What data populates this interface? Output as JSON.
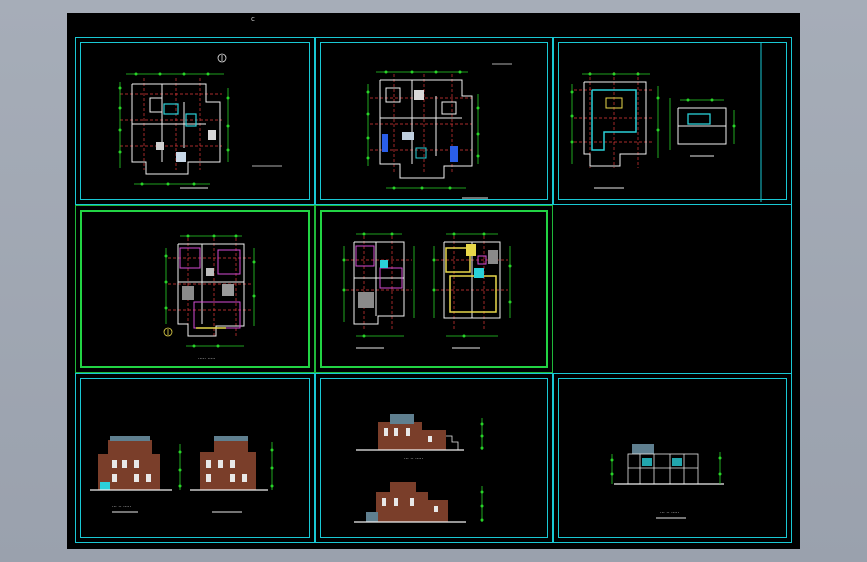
{
  "viewport": {
    "background": "#000000",
    "frame_color": "#19c8d4",
    "sheet_green": "#22d444"
  },
  "marker": "c",
  "sheets": [
    {
      "id": "sheet-1",
      "type": "floor-plan",
      "border": "cyan",
      "title": ""
    },
    {
      "id": "sheet-2",
      "type": "floor-plan",
      "border": "cyan",
      "title": ""
    },
    {
      "id": "sheet-3",
      "type": "roof-plan",
      "border": "cyan",
      "title": ""
    },
    {
      "id": "sheet-4",
      "type": "floor-plan",
      "border": "green",
      "title": "·····   ·····"
    },
    {
      "id": "sheet-5",
      "type": "floor-plan-pair",
      "border": "green",
      "title": ""
    },
    {
      "id": "sheet-6",
      "type": "empty",
      "border": "none",
      "title": ""
    },
    {
      "id": "sheet-7",
      "type": "elevation-pair",
      "border": "cyan",
      "title": "··· ·· ·····"
    },
    {
      "id": "sheet-8",
      "type": "elevation-stack",
      "border": "cyan",
      "title": "··· ·· ·····"
    },
    {
      "id": "sheet-9",
      "type": "elevation",
      "border": "cyan",
      "title": "··· ·· ·····"
    }
  ],
  "axis_marker": "①"
}
